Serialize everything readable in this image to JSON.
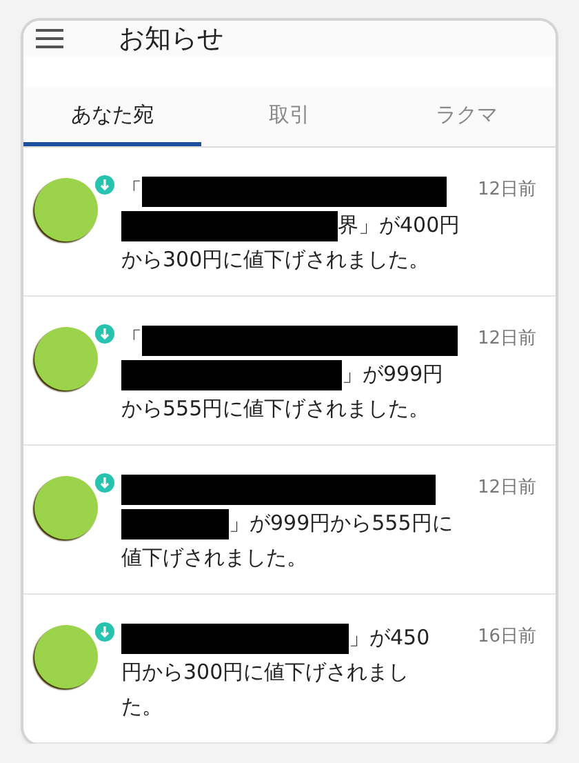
{
  "header": {
    "title": "お知らせ"
  },
  "tabs": [
    {
      "label": "あなた宛",
      "selected": true
    },
    {
      "label": "取引",
      "selected": false
    },
    {
      "label": "ラクマ",
      "selected": false
    }
  ],
  "notifications": [
    {
      "time": "12日前",
      "lines": [
        [
          {
            "kind": "text",
            "text": "「"
          },
          {
            "kind": "redaction"
          }
        ],
        [
          {
            "kind": "redaction"
          },
          {
            "kind": "text",
            "text": "界」が400円"
          }
        ],
        [
          {
            "kind": "text",
            "text": "から300円に値下げされました。"
          }
        ]
      ]
    },
    {
      "time": "12日前",
      "lines": [
        [
          {
            "kind": "text",
            "text": "「"
          },
          {
            "kind": "redaction"
          }
        ],
        [
          {
            "kind": "redaction"
          },
          {
            "kind": "text",
            "text": "」が999円"
          }
        ],
        [
          {
            "kind": "text",
            "text": "から555円に値下げされました。"
          }
        ]
      ]
    },
    {
      "time": "12日前",
      "lines": [
        [
          {
            "kind": "redaction"
          }
        ],
        [
          {
            "kind": "redaction"
          },
          {
            "kind": "text",
            "text": "」が999円から555円に"
          }
        ],
        [
          {
            "kind": "text",
            "text": "値下げされました。"
          }
        ]
      ]
    },
    {
      "time": "16日前",
      "lines": [
        [
          {
            "kind": "redaction"
          },
          {
            "kind": "text",
            "text": "」が450"
          }
        ],
        [
          {
            "kind": "text",
            "text": "円から300円に値下げされまし"
          }
        ],
        [
          {
            "kind": "text",
            "text": "た。"
          }
        ]
      ]
    }
  ]
}
